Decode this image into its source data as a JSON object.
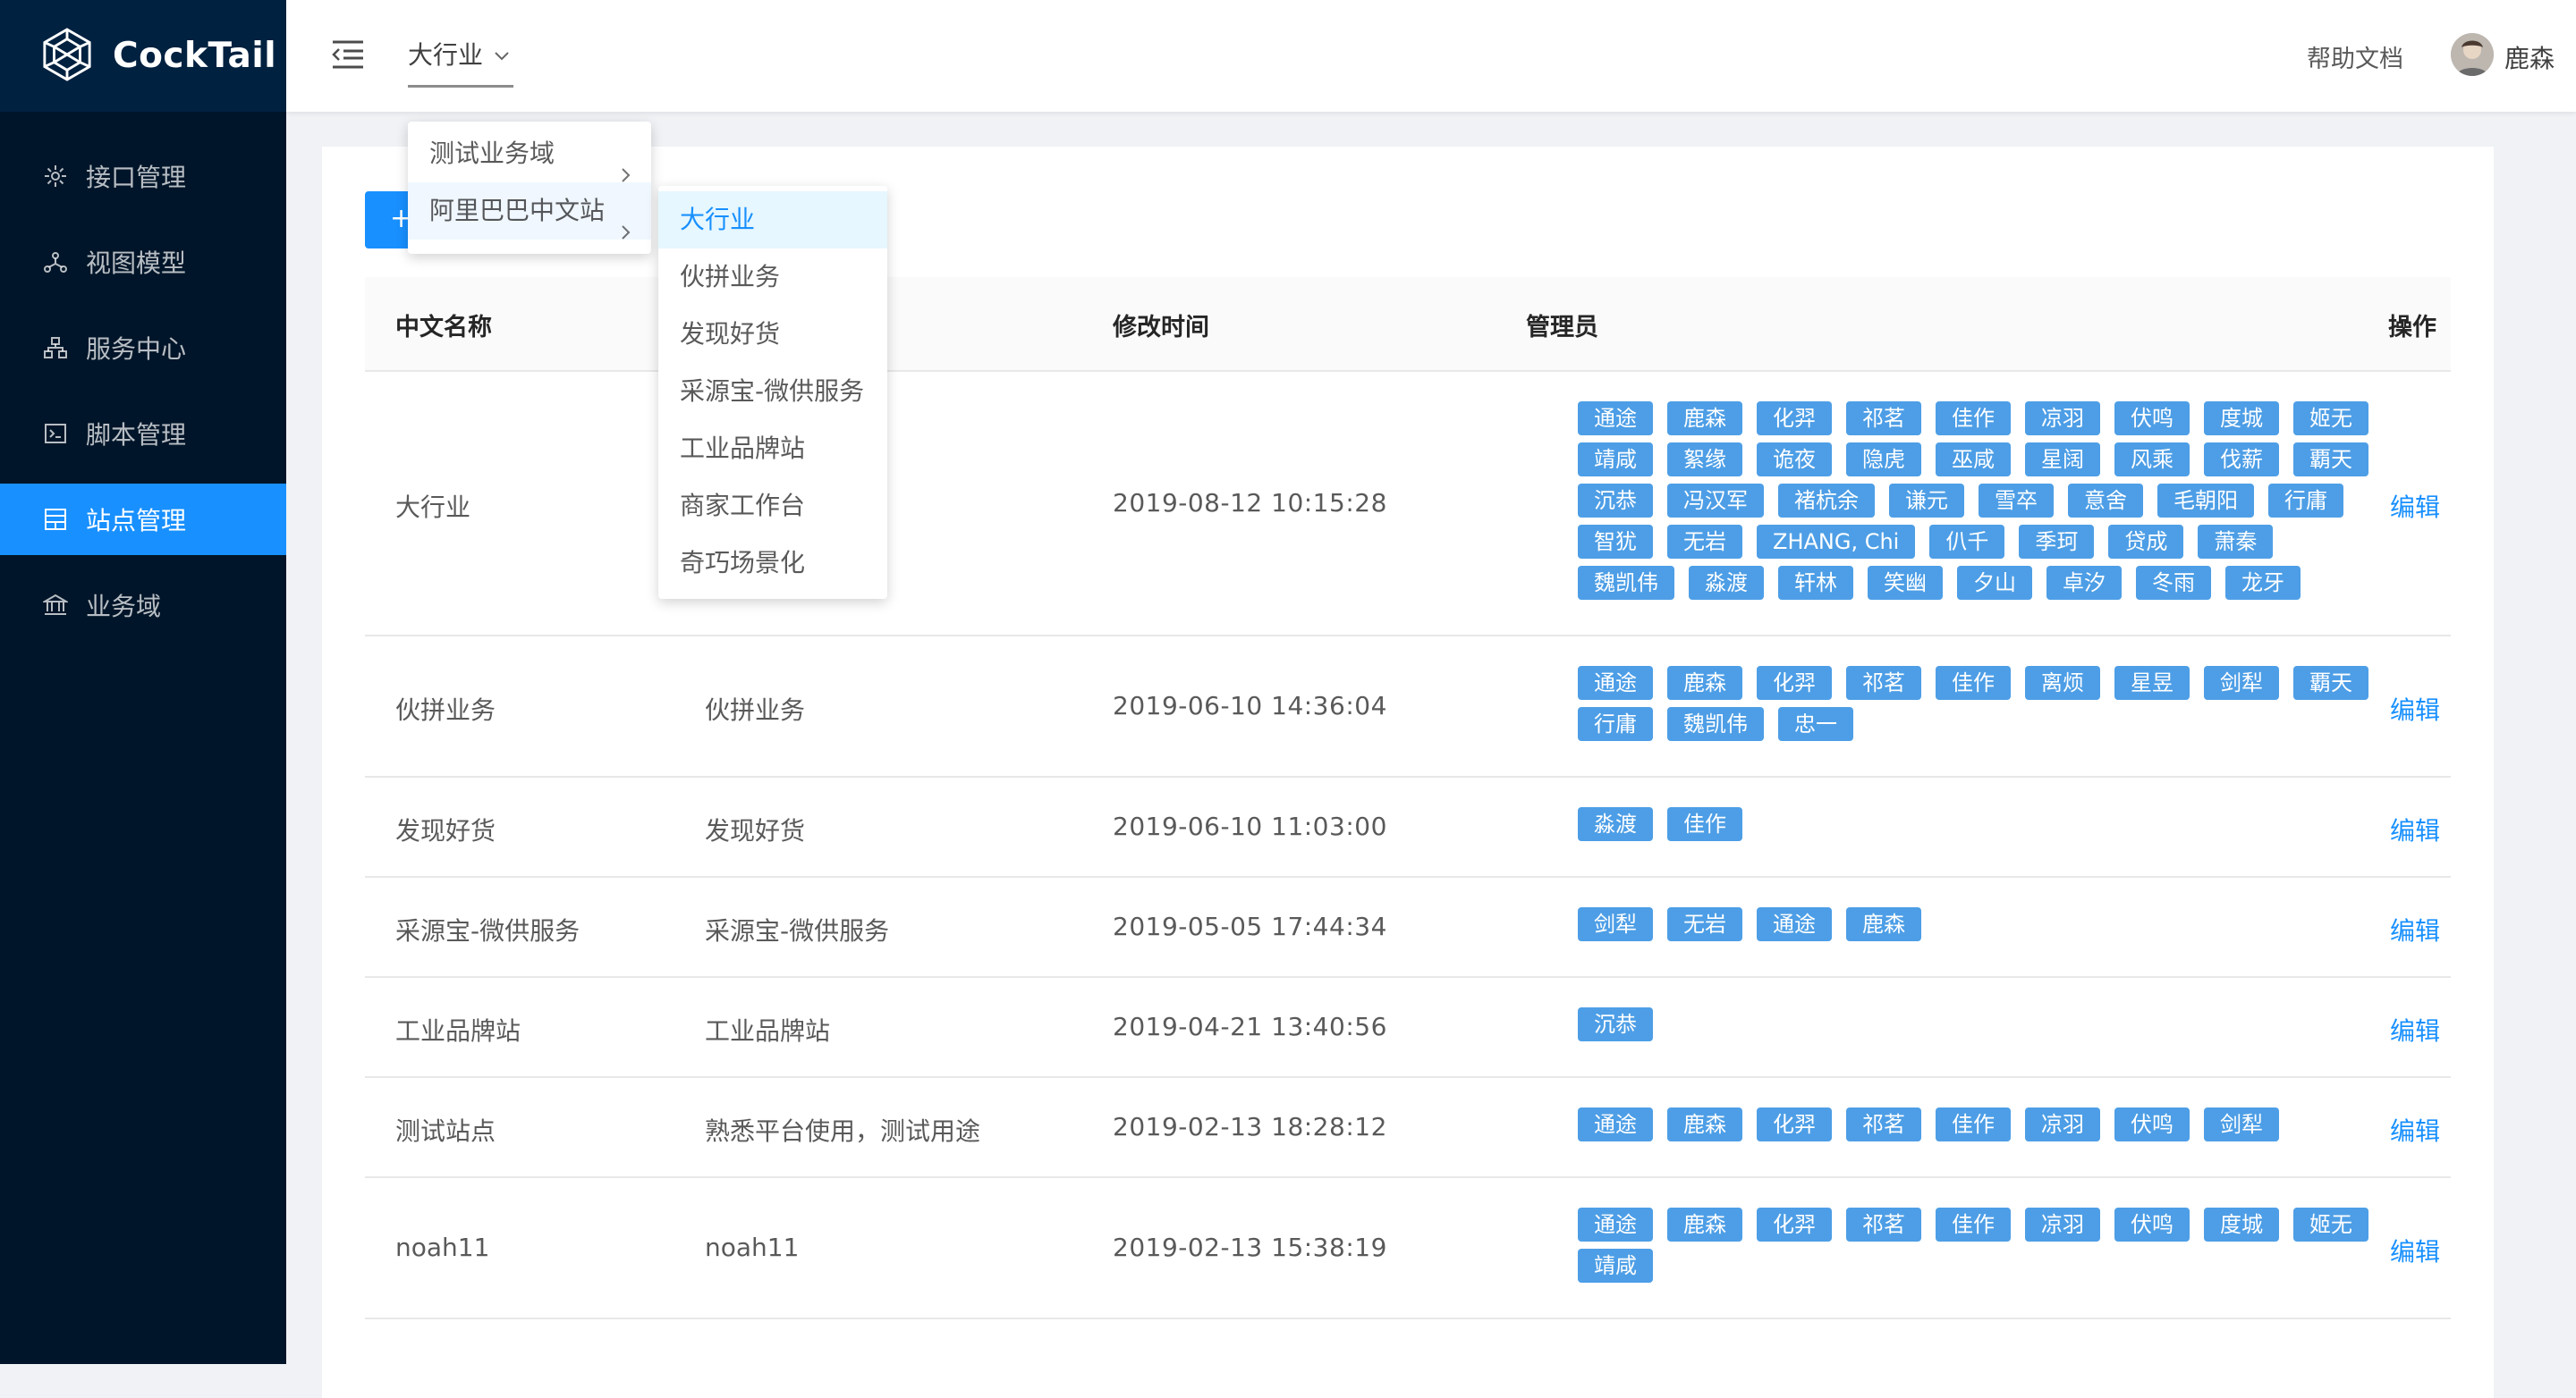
{
  "app": {
    "name": "CockTail"
  },
  "sidebar": {
    "items": [
      {
        "label": "接口管理",
        "icon": "gear-icon",
        "active": false
      },
      {
        "label": "视图模型",
        "icon": "network-icon",
        "active": false
      },
      {
        "label": "服务中心",
        "icon": "hierarchy-icon",
        "active": false
      },
      {
        "label": "脚本管理",
        "icon": "terminal-icon",
        "active": false
      },
      {
        "label": "站点管理",
        "icon": "site-icon",
        "active": true
      },
      {
        "label": "业务域",
        "icon": "bank-icon",
        "active": false
      }
    ]
  },
  "header": {
    "domain_select": "大行业",
    "help_label": "帮助文档",
    "user_name": "鹿森"
  },
  "cascader": {
    "level1": [
      {
        "label": "测试业务域"
      },
      {
        "label": "阿里巴巴中文站",
        "active": true
      }
    ],
    "level2": [
      {
        "label": "大行业",
        "active": true
      },
      {
        "label": "伙拼业务"
      },
      {
        "label": "发现好货"
      },
      {
        "label": "采源宝-微供服务"
      },
      {
        "label": "工业品牌站"
      },
      {
        "label": "商家工作台"
      },
      {
        "label": "奇巧场景化"
      }
    ]
  },
  "toolbar": {
    "add_label": "+"
  },
  "table": {
    "headers": {
      "name": "中文名称",
      "time": "修改时间",
      "admin": "管理员",
      "action": "操作"
    },
    "edit_label": "编辑",
    "rows": [
      {
        "name": "大行业",
        "desc": "",
        "time": "2019-08-12 10:15:28",
        "admins": [
          "通途",
          "鹿森",
          "化羿",
          "祁茗",
          "佳作",
          "凉羽",
          "伏鸣",
          "度城",
          "姬无",
          "靖咸",
          "絮缘",
          "诡夜",
          "隐虎",
          "巫咸",
          "星阔",
          "风乘",
          "伐薪",
          "覇天",
          "沉恭",
          "冯汉军",
          "褚杭余",
          "谦元",
          "雪卒",
          "意舍",
          "毛朝阳",
          "行庸",
          "智犹",
          "无岩",
          "ZHANG, Chi",
          "仈千",
          "季珂",
          "贷成",
          "萧秦",
          "魏凯伟",
          "淼渡",
          "轩林",
          "笑幽",
          "夕山",
          "卓汐",
          "冬雨",
          "龙牙"
        ]
      },
      {
        "name": "伙拼业务",
        "desc": "伙拼业务",
        "time": "2019-06-10 14:36:04",
        "admins": [
          "通途",
          "鹿森",
          "化羿",
          "祁茗",
          "佳作",
          "离烦",
          "星昱",
          "剑犁",
          "覇天",
          "行庸",
          "魏凯伟",
          "忠一"
        ]
      },
      {
        "name": "发现好货",
        "desc": "发现好货",
        "time": "2019-06-10 11:03:00",
        "admins": [
          "淼渡",
          "佳作"
        ]
      },
      {
        "name": "采源宝-微供服务",
        "desc": "采源宝-微供服务",
        "time": "2019-05-05 17:44:34",
        "admins": [
          "剑犁",
          "无岩",
          "通途",
          "鹿森"
        ]
      },
      {
        "name": "工业品牌站",
        "desc": "工业品牌站",
        "time": "2019-04-21 13:40:56",
        "admins": [
          "沉恭"
        ]
      },
      {
        "name": "测试站点",
        "desc": "熟悉平台使用，测试用途",
        "time": "2019-02-13 18:28:12",
        "admins": [
          "通途",
          "鹿森",
          "化羿",
          "祁茗",
          "佳作",
          "凉羽",
          "伏鸣",
          "剑犁"
        ]
      },
      {
        "name": "noah11",
        "desc": "noah11",
        "time": "2019-02-13 15:38:19",
        "admins": [
          "通途",
          "鹿森",
          "化羿",
          "祁茗",
          "佳作",
          "凉羽",
          "伏鸣",
          "度城",
          "姬无",
          "靖咸"
        ]
      }
    ]
  },
  "colors": {
    "sidebar": "#001529",
    "accent": "#1890ff",
    "tag": "#4d9ee6"
  }
}
